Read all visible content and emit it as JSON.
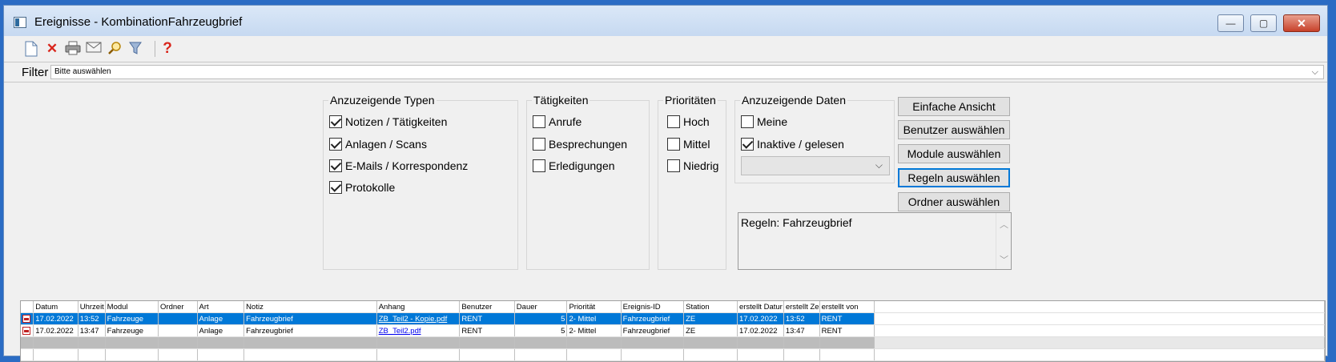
{
  "window": {
    "title": "Ereignisse - KombinationFahrzeugbrief",
    "controls": {
      "minimize": "—",
      "maximize": "▢",
      "close": "✕"
    }
  },
  "toolbar": {
    "icons": [
      "new-document-icon",
      "delete-icon",
      "print-icon",
      "email-icon",
      "search-icon",
      "filter-icon",
      "help-icon"
    ]
  },
  "filter": {
    "label": "Filter",
    "value": "Bitte auswählen"
  },
  "types": {
    "legend": "Anzuzeigende Typen",
    "items": [
      {
        "label": "Notizen / Tätigkeiten",
        "checked": true
      },
      {
        "label": "Anlagen / Scans",
        "checked": true
      },
      {
        "label": "E-Mails / Korrespondenz",
        "checked": true
      },
      {
        "label": "Protokolle",
        "checked": true
      }
    ]
  },
  "activities": {
    "legend": "Tätigkeiten",
    "items": [
      {
        "label": "Anrufe",
        "checked": false
      },
      {
        "label": "Besprechungen",
        "checked": false
      },
      {
        "label": "Erledigungen",
        "checked": false
      }
    ]
  },
  "priorities": {
    "legend": "Prioritäten",
    "items": [
      {
        "label": "Hoch",
        "checked": false
      },
      {
        "label": "Mittel",
        "checked": false
      },
      {
        "label": "Niedrig",
        "checked": false
      }
    ]
  },
  "data_filter": {
    "legend": "Anzuzeigende Daten",
    "items": [
      {
        "label": "Meine",
        "checked": false
      },
      {
        "label": "Inaktive / gelesen",
        "checked": true
      }
    ],
    "combo_value": ""
  },
  "buttons": {
    "simple_view": "Einfache Ansicht",
    "select_users": "Benutzer auswählen",
    "select_modules": "Module auswählen",
    "select_rules": "Regeln auswählen",
    "select_folders": "Ordner auswählen"
  },
  "rules_box": {
    "text": "Regeln: Fahrzeugbrief"
  },
  "grid": {
    "columns": [
      "",
      "Datum",
      "Uhrzeit",
      "Modul",
      "Ordner",
      "Art",
      "Notiz",
      "Anhang",
      "Benutzer",
      "Dauer",
      "Priorität",
      "Ereignis-ID",
      "Station",
      "erstellt Datur",
      "erstellt Ze",
      "erstellt von"
    ],
    "rows": [
      {
        "datum": "17.02.2022",
        "uhrzeit": "13:52",
        "modul": "Fahrzeuge",
        "ordner": "",
        "art": "Anlage",
        "notiz": "Fahrzeugbrief",
        "anhang": "ZB_Teil2 - Kopie.pdf",
        "benutzer": "RENT",
        "dauer": "5",
        "prioritaet": "2- Mittel",
        "ereignis_id": "Fahrzeugbrief",
        "station": "ZE",
        "erstellt_datum": "17.02.2022",
        "erstellt_zeit": "13:52",
        "erstellt_von": "RENT",
        "selected": true
      },
      {
        "datum": "17.02.2022",
        "uhrzeit": "13:47",
        "modul": "Fahrzeuge",
        "ordner": "",
        "art": "Anlage",
        "notiz": "Fahrzeugbrief",
        "anhang": "ZB_Teil2.pdf",
        "benutzer": "RENT",
        "dauer": "5",
        "prioritaet": "2- Mittel",
        "ereignis_id": "Fahrzeugbrief",
        "station": "ZE",
        "erstellt_datum": "17.02.2022",
        "erstellt_zeit": "13:47",
        "erstellt_von": "RENT",
        "selected": false
      }
    ]
  },
  "colors": {
    "selection": "#0078d7",
    "delete_icon": "#d9261c",
    "help_icon": "#d9261c",
    "desktop": "#2b6cc4"
  }
}
